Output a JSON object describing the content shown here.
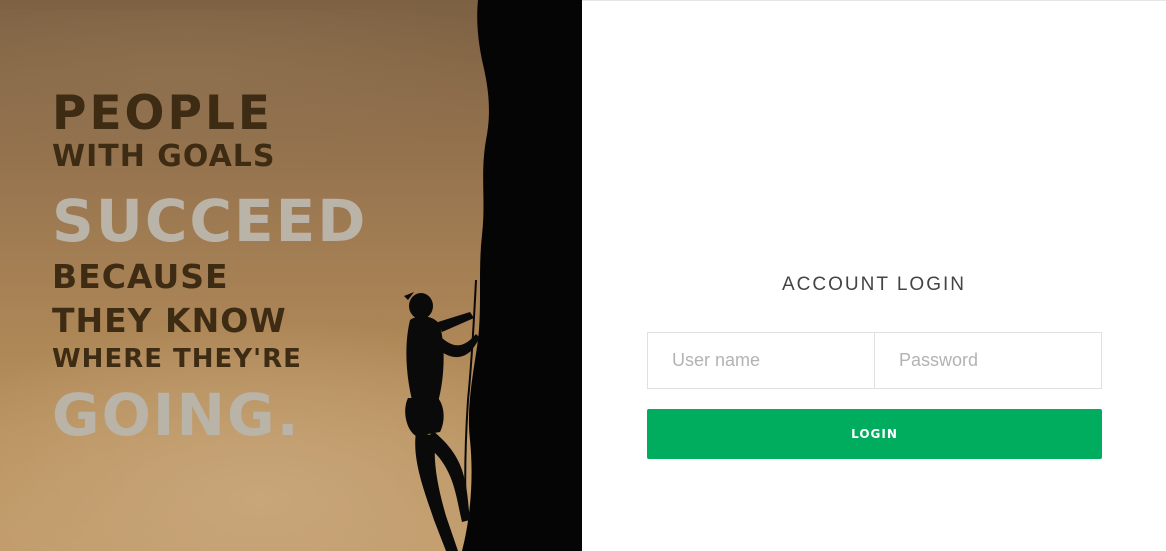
{
  "hero": {
    "quote_lines": [
      "PEOPLE",
      "WITH GOALS",
      "SUCCEED",
      "BECAUSE",
      "THEY KNOW",
      "WHERE THEY'RE",
      "GOING."
    ]
  },
  "login": {
    "title": "ACCOUNT LOGIN",
    "username_placeholder": "User name",
    "password_placeholder": "Password",
    "username_value": "",
    "password_value": "",
    "submit_label": "LOGIN"
  },
  "colors": {
    "accent": "#00ad5f",
    "quote_dark": "#3d2c13",
    "quote_light": "#b9b3a8"
  }
}
